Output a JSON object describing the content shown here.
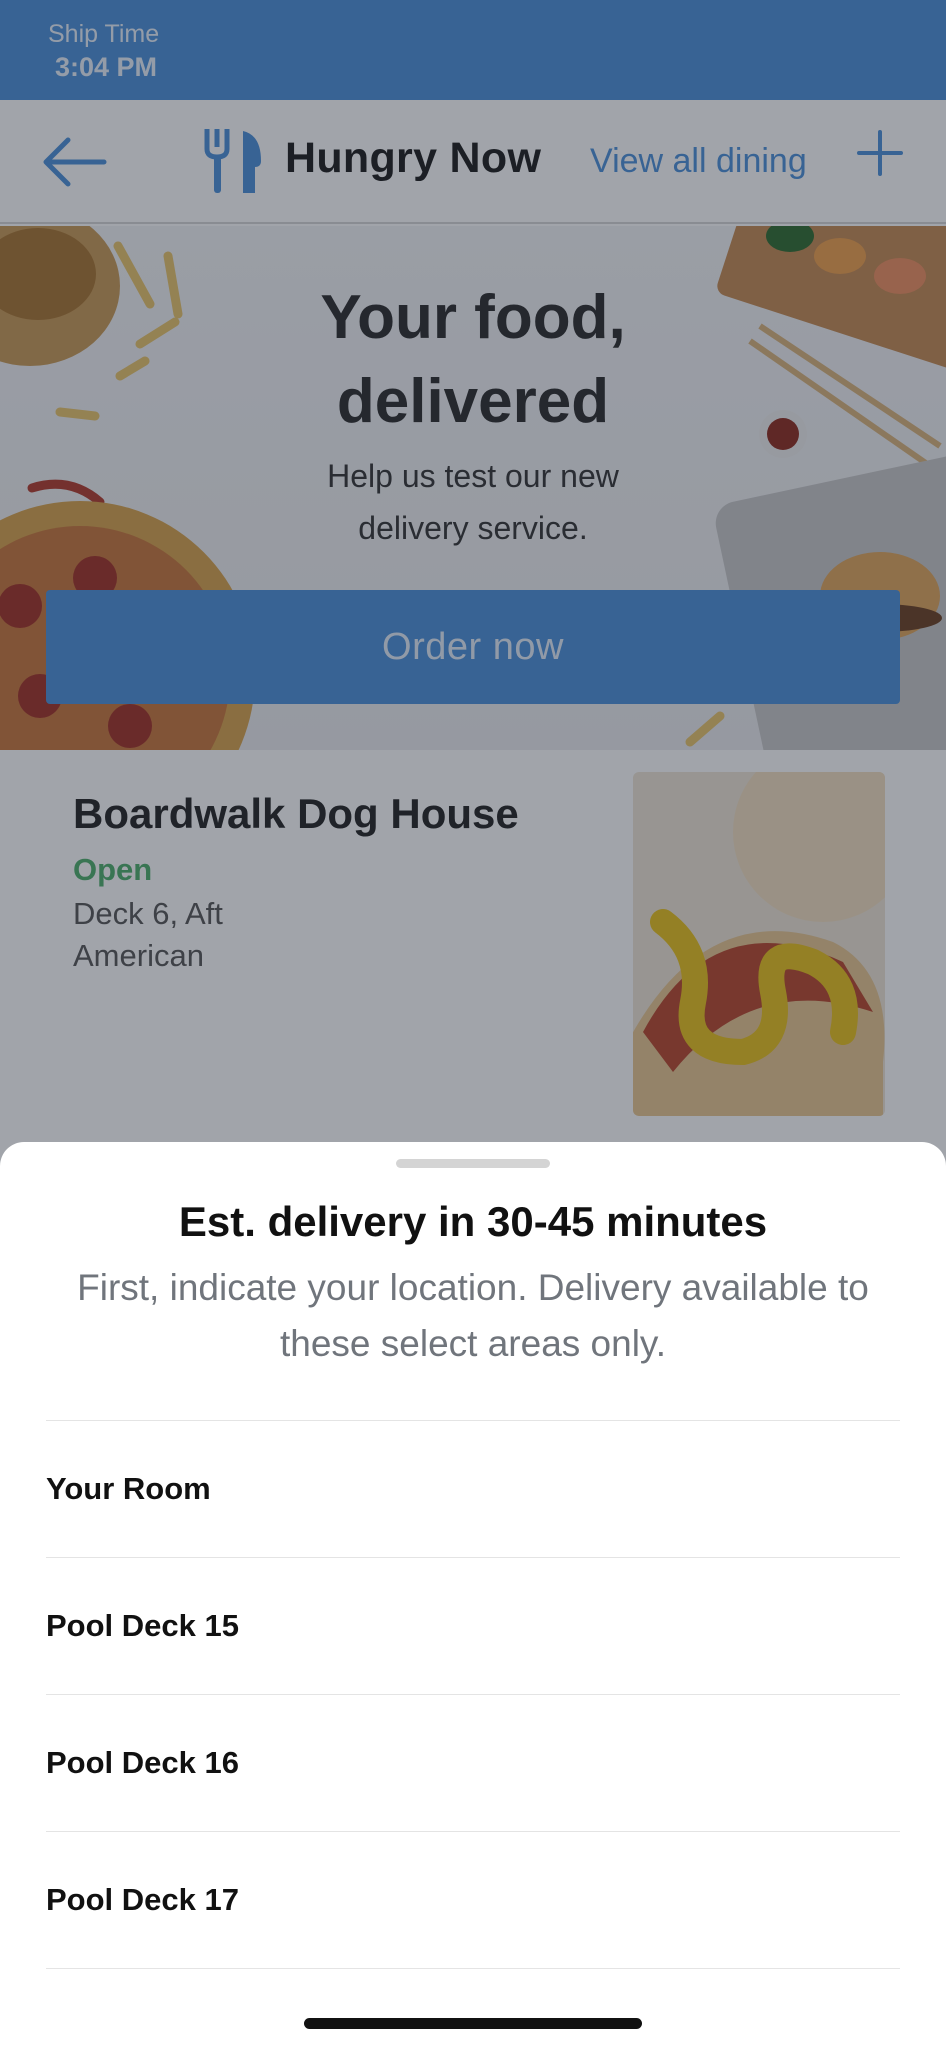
{
  "status_bar": {
    "ship_time_label": "Ship Time",
    "ship_time_value": "3:04 PM"
  },
  "header": {
    "back_icon": "arrow-left-icon",
    "venue_icon": "fork-knife-icon",
    "title": "Hungry Now",
    "view_all_label": "View all dining",
    "add_icon": "plus-icon"
  },
  "hero": {
    "title_line1": "Your food,",
    "title_line2": "delivered",
    "subtitle_line1": "Help us test our new",
    "subtitle_line2": "delivery service.",
    "order_button_label": "Order now"
  },
  "restaurant": {
    "name": "Boardwalk Dog House",
    "status": "Open",
    "location": "Deck 6, Aft",
    "cuisine": "American",
    "image_icon": "hot-dog-image"
  },
  "sheet": {
    "title": "Est. delivery in 30-45 minutes",
    "subtitle": "First, indicate your location. Delivery available to these select areas only.",
    "locations": [
      "Your Room",
      "Pool Deck 15",
      "Pool Deck 16",
      "Pool Deck 17"
    ]
  },
  "colors": {
    "accent": "#4a90d9",
    "open_status": "#4caf6a",
    "overlay": "rgba(30,38,52,0.42)"
  }
}
